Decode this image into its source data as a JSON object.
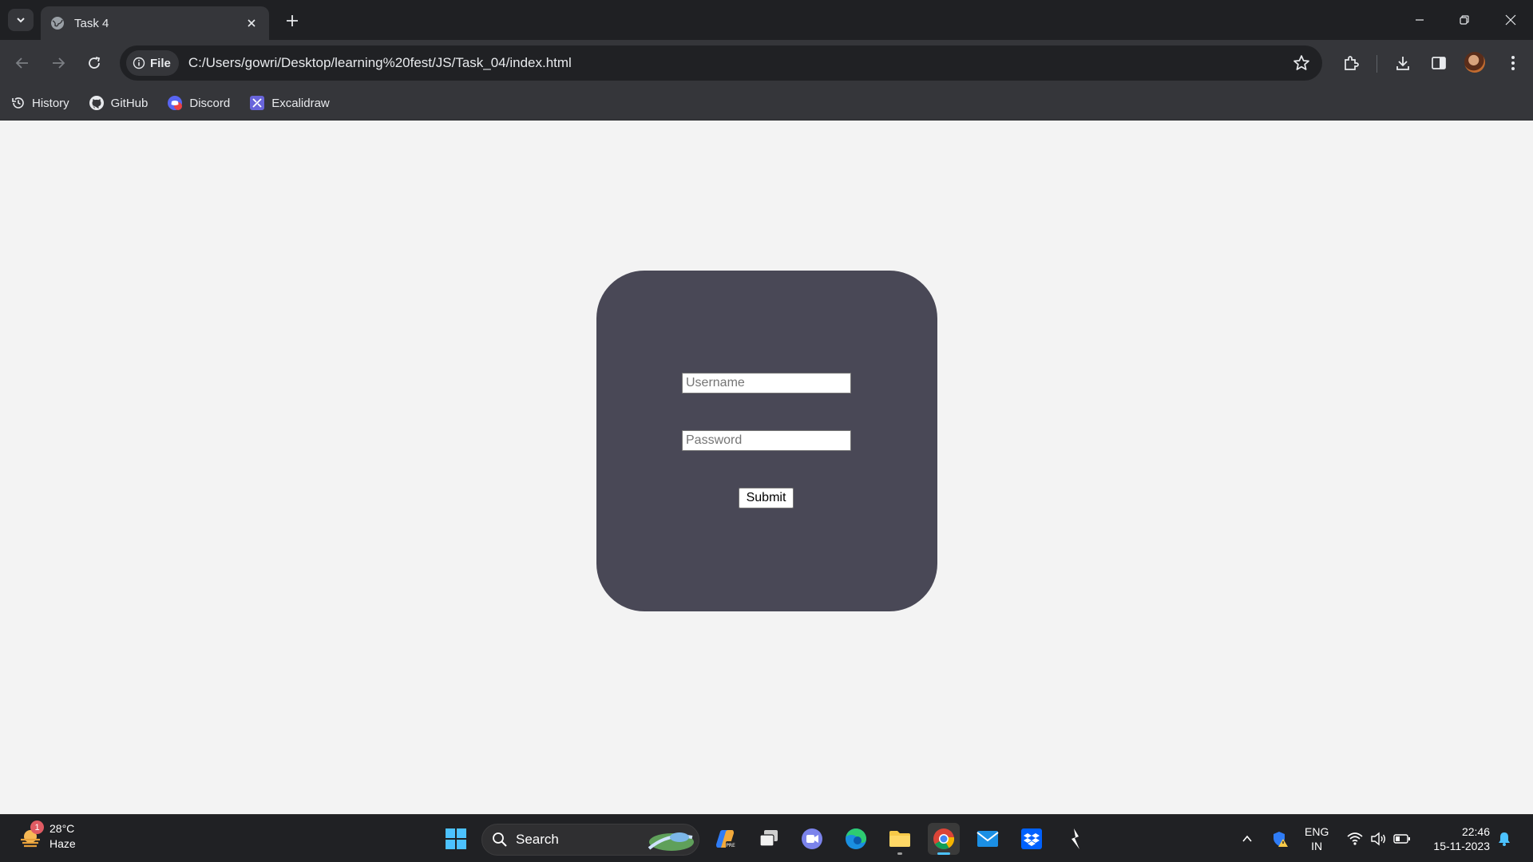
{
  "browser": {
    "tab_title": "Task 4",
    "address_chip": "File",
    "url": "C:/Users/gowri/Desktop/learning%20fest/JS/Task_04/index.html",
    "bookmarks": [
      {
        "label": "History",
        "icon": "history-icon"
      },
      {
        "label": "GitHub",
        "icon": "github-icon"
      },
      {
        "label": "Discord",
        "icon": "discord-icon"
      },
      {
        "label": "Excalidraw",
        "icon": "excalidraw-icon"
      }
    ]
  },
  "form": {
    "username_placeholder": "Username",
    "password_placeholder": "Password",
    "username_value": "",
    "password_value": "",
    "submit_label": "Submit"
  },
  "taskbar": {
    "weather_temp": "28°C",
    "weather_desc": "Haze",
    "weather_badge": "1",
    "search_label": "Search",
    "lang_line1": "ENG",
    "lang_line2": "IN",
    "time": "22:46",
    "date": "15-11-2023"
  },
  "colors": {
    "card": "#494856",
    "page_bg": "#f3f3f3",
    "chrome_dark": "#35363a",
    "taskbar": "#202124"
  }
}
